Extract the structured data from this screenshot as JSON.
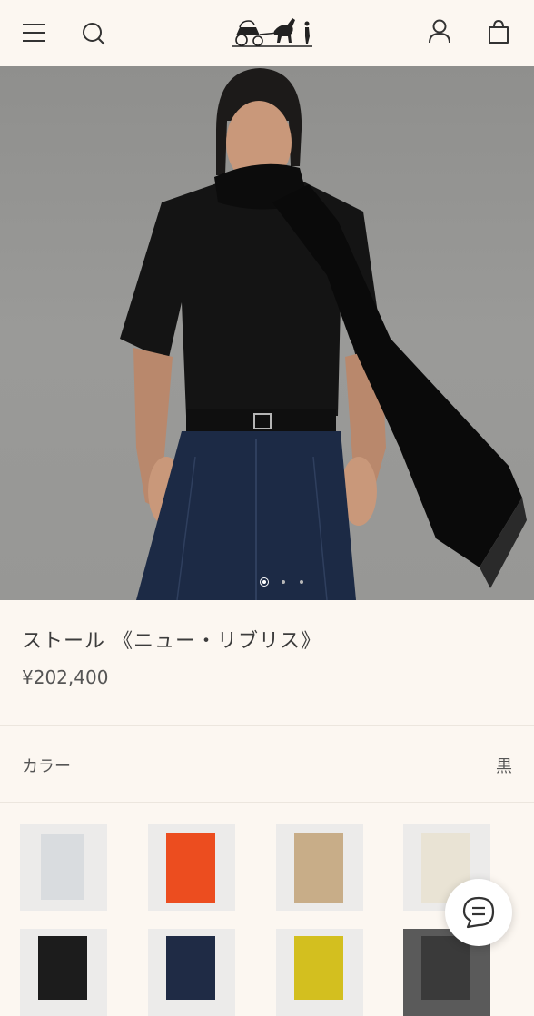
{
  "header": {
    "menu_icon": "hamburger-menu-icon",
    "search_icon": "search-icon",
    "logo": "horse-carriage-logo",
    "account_icon": "person-icon",
    "bag_icon": "shopping-bag-icon"
  },
  "hero": {
    "image": "model-wearing-black-stole",
    "carousel_count": 3,
    "carousel_active_index": 0
  },
  "product": {
    "title": "ストール 《ニュー・リブリス》",
    "price": "¥202,400"
  },
  "color": {
    "label": "カラー",
    "selected": "黒"
  },
  "swatches": [
    {
      "name": "light-gray",
      "color": "#d9dcdf"
    },
    {
      "name": "orange",
      "color": "#ec4d1f"
    },
    {
      "name": "camel",
      "color": "#c8ad88"
    },
    {
      "name": "ecru",
      "color": "#e9e3d4"
    },
    {
      "name": "black",
      "color": "#1c1c1c"
    },
    {
      "name": "navy",
      "color": "#1f2b45"
    },
    {
      "name": "yellow",
      "color": "#d3bf1f"
    },
    {
      "name": "more",
      "color": "#3a3a3a"
    }
  ],
  "chat": {
    "icon": "chat-bubble-icon"
  }
}
